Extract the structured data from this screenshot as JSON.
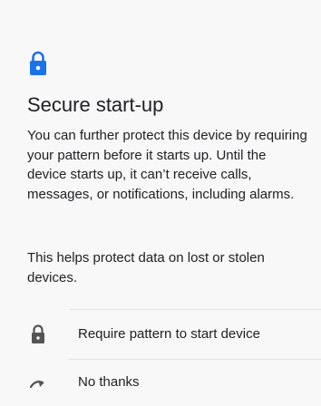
{
  "header": {
    "icon": "lock-icon",
    "accent_color": "#1a73e8"
  },
  "title": "Secure start-up",
  "description": {
    "paragraph1": "You can further protect this device by requiring your pattern before it starts up. Until the device starts up, it can’t receive calls, messages, or notifications, including alarms.",
    "paragraph2": "This helps protect data on lost or stolen devices."
  },
  "options": [
    {
      "label": "Require pattern to start device",
      "icon": "lock-icon"
    },
    {
      "label": "No thanks",
      "icon": "skip-arrow-icon"
    }
  ],
  "colors": {
    "icon_gray": "#555555",
    "divider": "#e2e2e2"
  }
}
